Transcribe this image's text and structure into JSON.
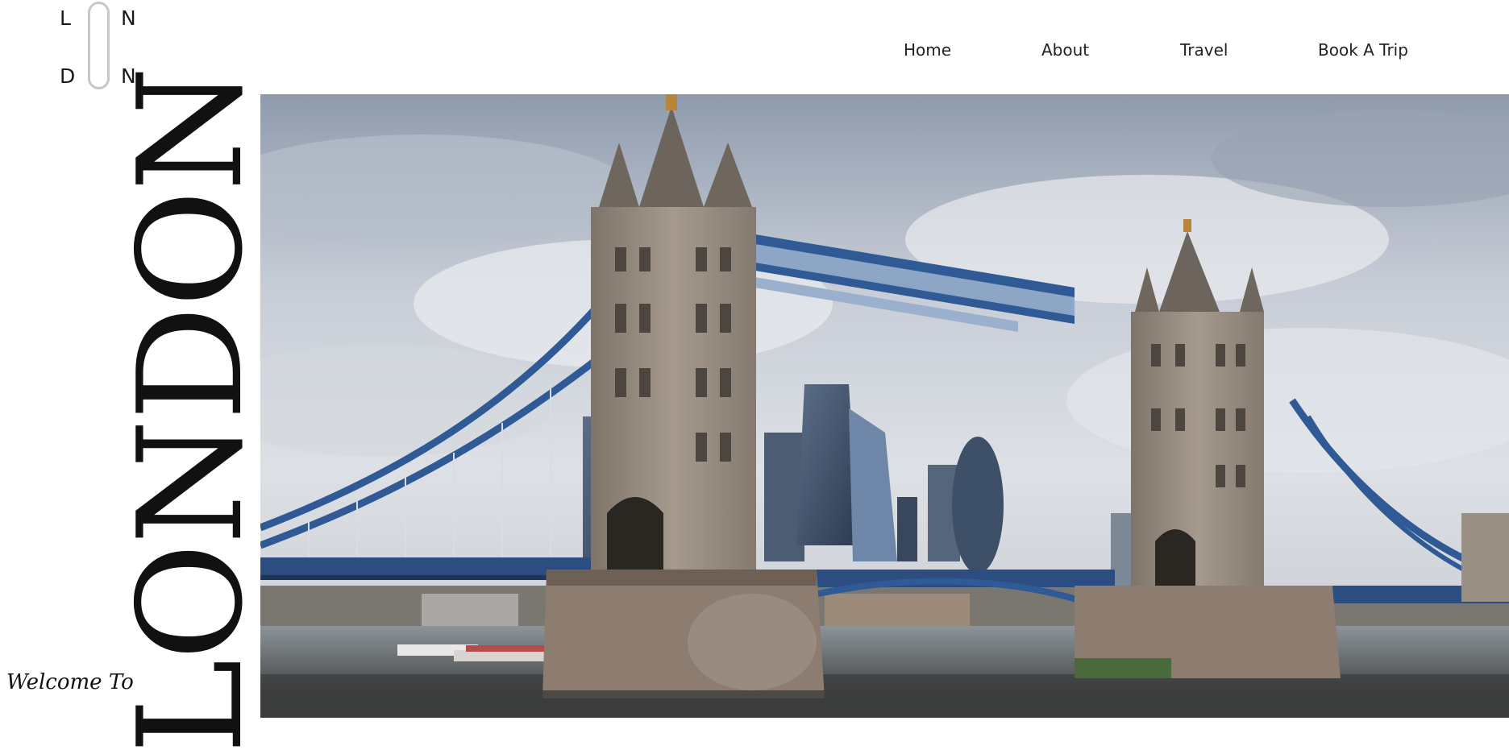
{
  "logo": {
    "letters": [
      "L",
      "N",
      "D",
      "N"
    ]
  },
  "nav": {
    "items": [
      {
        "label": "Home"
      },
      {
        "label": "About"
      },
      {
        "label": "Travel"
      },
      {
        "label": "Book A Trip"
      }
    ]
  },
  "hero": {
    "title": "LONDON",
    "welcome": "Welcome To",
    "image_icon": "tower-bridge-photo"
  },
  "colors": {
    "text": "#111111",
    "bridge_blue": "#2f5a96",
    "stone": "#9a8f84"
  }
}
